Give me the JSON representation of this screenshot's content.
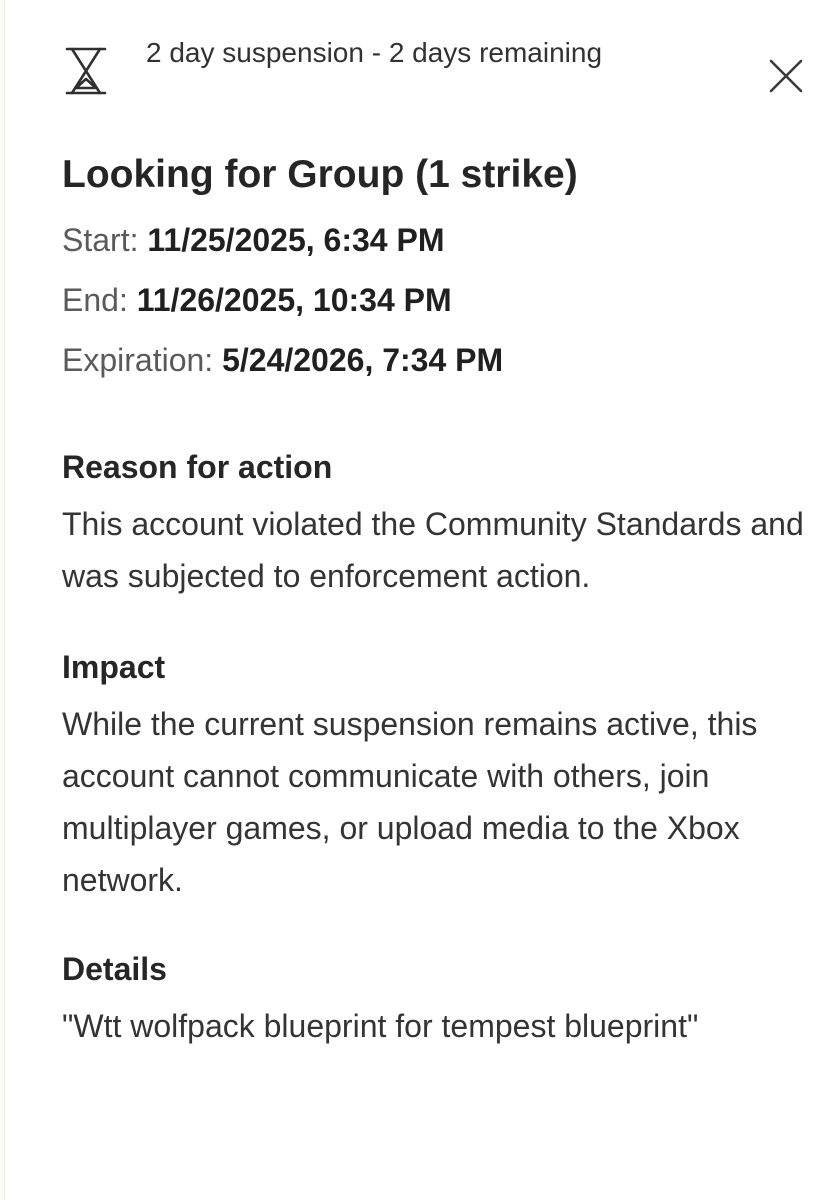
{
  "header": {
    "status_text": "2 day suspension - 2 days remaining",
    "icon": "hourglass-icon",
    "close_icon": "close-icon"
  },
  "enforcement": {
    "title": "Looking for Group (1 strike)",
    "start_label": "Start:",
    "start_value": "11/25/2025, 6:34 PM",
    "end_label": "End:",
    "end_value": "11/26/2025, 10:34 PM",
    "expiration_label": "Expiration:",
    "expiration_value": "5/24/2026, 7:34 PM"
  },
  "sections": {
    "reason": {
      "title": "Reason for action",
      "body": "This account violated the Community Standards and was subjected to enforcement action."
    },
    "impact": {
      "title": "Impact",
      "body": "While the current suspension remains active, this account cannot communicate with others, join multiplayer games, or upload media to the Xbox network."
    },
    "details": {
      "title": "Details",
      "body": "\"Wtt wolfpack blueprint for tempest blueprint\""
    }
  }
}
